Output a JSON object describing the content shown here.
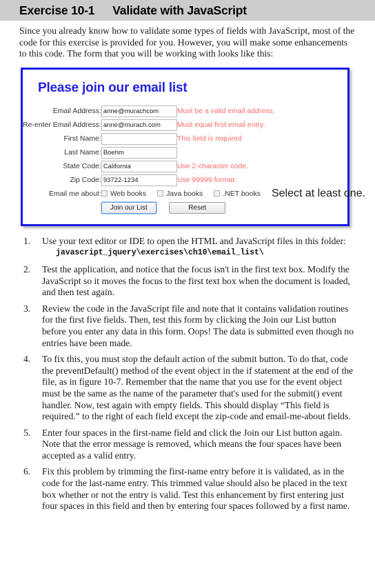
{
  "header": {
    "exercise_number": "Exercise 10-1",
    "exercise_title": "Validate with JavaScript"
  },
  "intro": {
    "paragraph": "Since you already know how to validate some types of fields with JavaScript, most of the code for this exercise is provided for you. However, you will make some enhancements to this code. The form that you will be working with looks like this:"
  },
  "form": {
    "title": "Please join our email list",
    "fields": [
      {
        "label": "Email Address:",
        "value": "anne@murachcom",
        "error": "Must be a valid email address."
      },
      {
        "label": "Re-enter Email Address:",
        "value": "anne@murach.com",
        "error": "Must equal first email entry."
      },
      {
        "label": "First Name:",
        "value": "",
        "error": "This field is required."
      },
      {
        "label": "Last Name:",
        "value": "Boehm",
        "error": ""
      },
      {
        "label": "State Code:",
        "value": "California",
        "error": "Use 2-character code."
      },
      {
        "label": "Zip Code:",
        "value": "93722-1234",
        "error": "Use 99999 format."
      }
    ],
    "checkbox_row": {
      "label": "Email me about:",
      "options": [
        {
          "label": "Web books",
          "checked": false
        },
        {
          "label": "Java books",
          "checked": false
        },
        {
          "label": ".NET books",
          "checked": false
        }
      ],
      "error": "Select at least one."
    },
    "buttons": {
      "submit": "Join our List",
      "reset": "Reset"
    },
    "colors": {
      "border": "#1a1ae6",
      "title": "#2222dd",
      "error_text": "#ff6a6a",
      "header_bar": "#cccccc"
    }
  },
  "steps": [
    {
      "text": "Use your text editor or IDE to open the HTML and JavaScript files in this folder:",
      "code": "javascript_jquery\\exercises\\ch10\\email_list\\"
    },
    {
      "text": "Test the application, and notice that the focus isn't in the first text box. Modify the JavaScript so it moves the focus to the first text box when the document is loaded, and then test again.",
      "code": ""
    },
    {
      "text": "Review the code in the JavaScript file and note that it contains validation routines for the first five fields. Then, test this form by clicking the Join our List button before you enter any data in this form. Oops! The data is submitted even though no entries have been made.",
      "code": ""
    },
    {
      "text": "To fix this, you must stop the default action of the submit button. To do that, code the preventDefault() method of the event object in the if statement at the end of the file, as in figure 10-7. Remember that the name that you use for the event object must be the same as the name of the parameter that's used for the submit() event handler. Now, test again with empty fields. This should display “This field is required.” to the right of each field except the zip-code and email-me-about fields.",
      "code": ""
    },
    {
      "text": "Enter four spaces in the first-name field and click the Join our List button again. Note that the error message is removed, which means the four spaces have been accepted as a valid entry.",
      "code": ""
    },
    {
      "text": "Fix this problem by trimming the first-name entry before it is validated, as in the code for the last-name entry. This trimmed value should also be placed in the text box whether or not the entry is valid. Test this enhancement by first entering just four spaces in this field and then by entering four spaces followed by a first name.",
      "code": ""
    }
  ]
}
